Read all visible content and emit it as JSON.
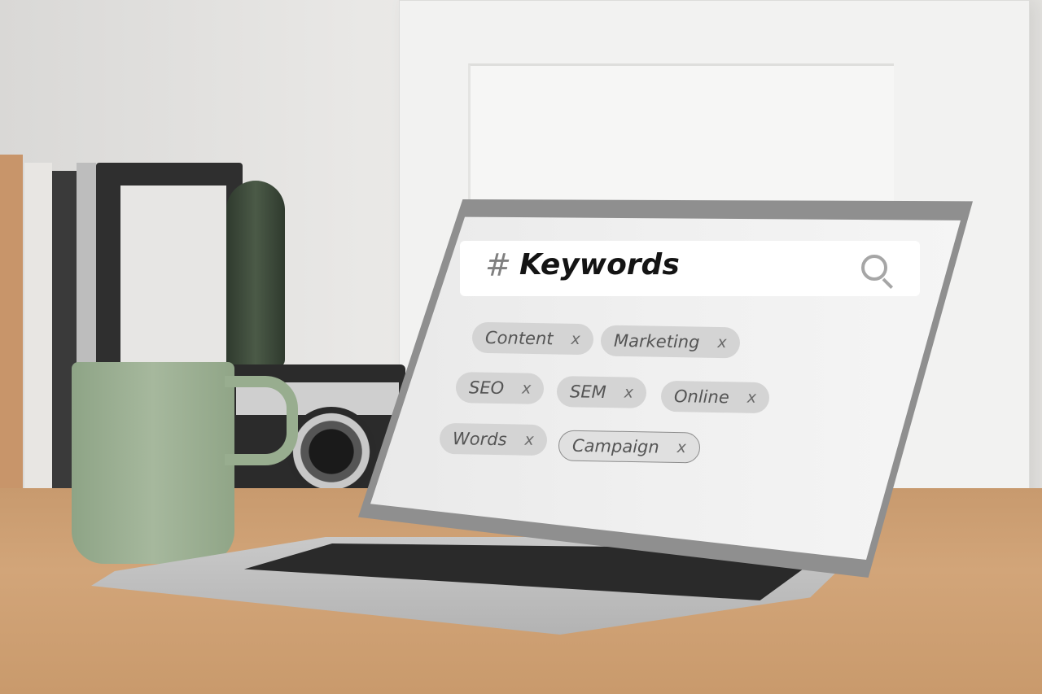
{
  "search": {
    "hash": "#",
    "title": "Keywords"
  },
  "tags": [
    {
      "label": "Content",
      "remove": "x"
    },
    {
      "label": "Marketing",
      "remove": "x"
    },
    {
      "label": "SEO",
      "remove": "x"
    },
    {
      "label": "SEM",
      "remove": "x"
    },
    {
      "label": "Online",
      "remove": "x"
    },
    {
      "label": "Words",
      "remove": "x"
    },
    {
      "label": "Campaign",
      "remove": "x"
    }
  ],
  "colors": {
    "mug": "#9aae92",
    "desk": "#cda173",
    "screen": "#eeeeee"
  }
}
